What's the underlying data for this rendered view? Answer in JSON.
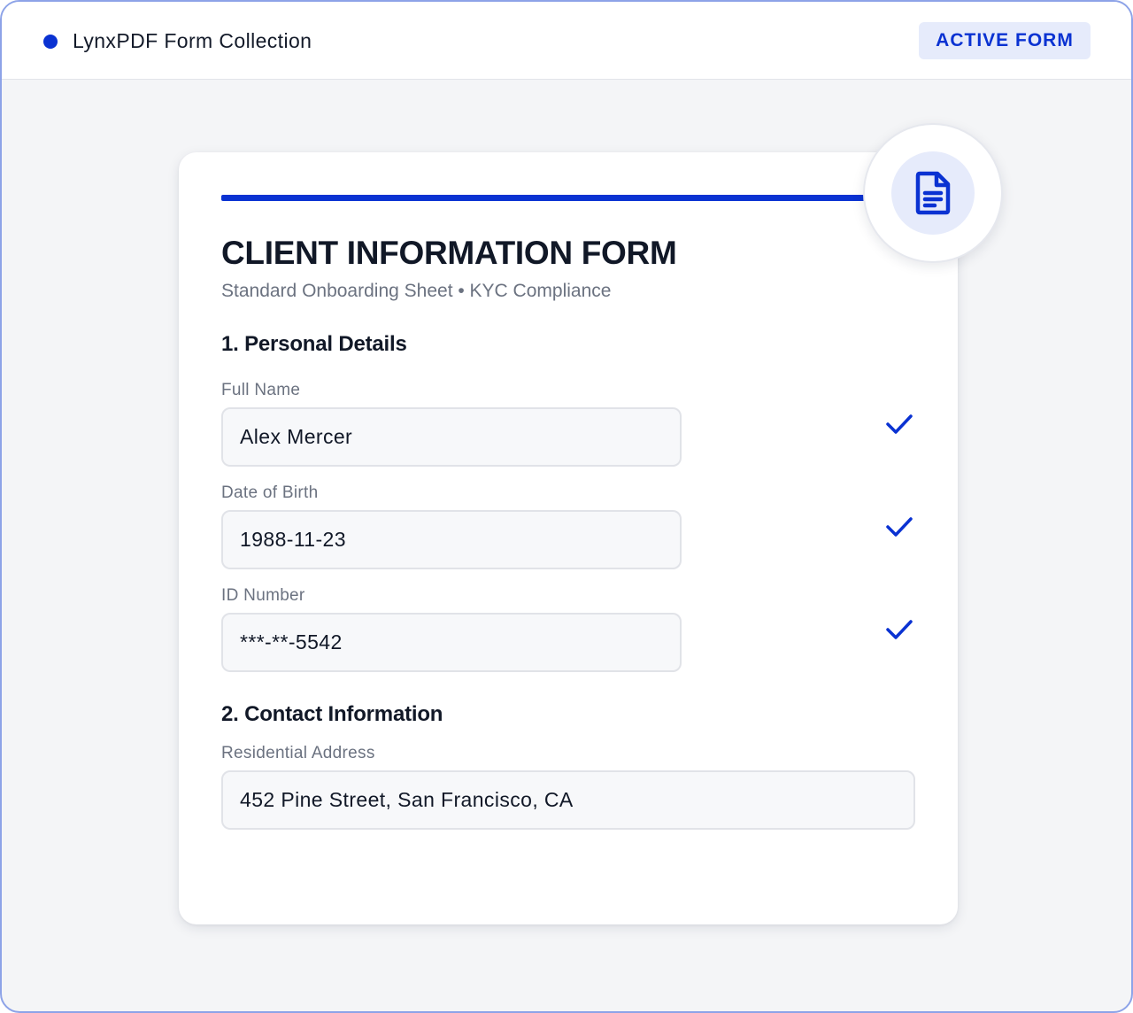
{
  "header": {
    "app_title": "LynxPDF Form Collection",
    "badge": "ACTIVE FORM"
  },
  "form": {
    "title": "CLIENT INFORMATION FORM",
    "subtitle": "Standard Onboarding Sheet • KYC Compliance",
    "icon": "document-icon",
    "sections": [
      {
        "title": "1. Personal Details",
        "fields": [
          {
            "label": "Full Name",
            "value": "Alex Mercer",
            "validated": true
          },
          {
            "label": "Date of Birth",
            "value": "1988-11-23",
            "validated": true
          },
          {
            "label": "ID Number",
            "value": "***-**-5542",
            "validated": true
          }
        ]
      },
      {
        "title": "2. Contact Information",
        "fields": [
          {
            "label": "Residential Address",
            "value": "452 Pine Street, San Francisco, CA",
            "validated": false
          }
        ]
      }
    ]
  },
  "colors": {
    "accent": "#0a32d2",
    "badge_bg": "#e6ebfb",
    "window_border": "#8da3e8"
  }
}
